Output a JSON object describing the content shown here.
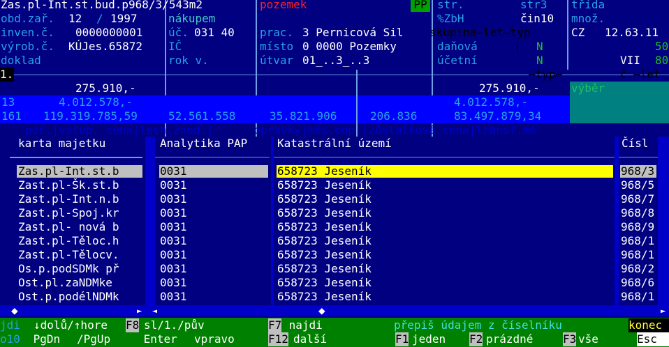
{
  "header": {
    "title": "Zas.pl-Int.st.bud.p968/3/543m2",
    "pozemek": "pozemek",
    "pp": "PP",
    "obd_label": "obd.zař.",
    "obd_month": "12",
    "obd_sep": "/",
    "obd_year": "1997",
    "inven_label": "inven.č.",
    "inven_value": "0000000001",
    "vyrob_label": "výrob.č.",
    "vyrob_value": "KÚJes.65872",
    "doklad_label": "doklad",
    "nakupem": "nákupem",
    "uc_label": "úč.",
    "uc_value": "031 40",
    "ic_label": "IČ",
    "rok_label": "rok v.",
    "prac_label": "prac.",
    "prac_value": "3 Pernicová Sil",
    "misto_label": "místo",
    "misto_value": "0 0000 Pozemky",
    "utvar_label": "útvar",
    "utvar_value": "01_..3_..3",
    "str_label": "str.",
    "zbh_label": "%ZbH",
    "skupina_line": "skupina—let—typ",
    "danova_label": "daňová",
    "danova_value": "N",
    "ucetni_label": "účetní",
    "ucetni_value": "N",
    "str3_label": "str3",
    "cin_label": "čin10",
    "cz_label": "CZ",
    "trida_label": "třída",
    "mnoz_label": "množ.",
    "cz_value": "12.63.11",
    "cz_val2": "50",
    "cz_val3": "80",
    "vii": "VII",
    "typ_line": "—typ—",
    "clet_line": "č.—let",
    "row_indicator": "1."
  },
  "values": {
    "row1_vstup": "275.910,-",
    "row1_zust": "275.910,-",
    "row2_num": "13",
    "row2_vstup": "4.012.578,-",
    "row2_zust": "4.012.578,-",
    "row3_num": "161",
    "row3_vstup": "119.319.785,59",
    "row3_tech": "52.561.558",
    "row3_opravky": "35.821.906",
    "row3_mes": "206.836",
    "row3_zust": "83.497.879,34",
    "vyber": "výběr",
    "labels": "poč.|vstup. cena|tech.zhod.|      opravky|měs.odp.|zůstatková cena|transf.mě"
  },
  "columns": {
    "karta": "karta majetku",
    "analytika": "Analytika PAP",
    "katastr": "Katastrální území",
    "cisl": "Čísl"
  },
  "rows": [
    {
      "karta": "Zas.pl-Int.st.b",
      "analytika": "0031",
      "katastr": "658723 Jeseník",
      "cisl": "968/3"
    },
    {
      "karta": "Zast.pl-Šk.st.b",
      "analytika": "0031",
      "katastr": "658723 Jeseník",
      "cisl": "968/5"
    },
    {
      "karta": "Zast.pl-Int.n.b",
      "analytika": "0031",
      "katastr": "658723 Jeseník",
      "cisl": "968/7"
    },
    {
      "karta": "Zast.pl-Spoj.kr",
      "analytika": "0031",
      "katastr": "658723 Jeseník",
      "cisl": "968/8"
    },
    {
      "karta": "Zast.pl- nová b",
      "analytika": "0031",
      "katastr": "658723 Jeseník",
      "cisl": "968/9"
    },
    {
      "karta": "Zast.pl-Těloc.h",
      "analytika": "0031",
      "katastr": "658723 Jeseník",
      "cisl": "968/1"
    },
    {
      "karta": "Zast.pl-Tělocv.",
      "analytika": "0031",
      "katastr": "658723 Jeseník",
      "cisl": "968/1"
    },
    {
      "karta": "Os.p.podSDMk př",
      "analytika": "0031",
      "katastr": "658723 Jeseník",
      "cisl": "968/2"
    },
    {
      "karta": "Ost.pl.zaNDMke ",
      "analytika": "0031",
      "katastr": "658723 Jeseník",
      "cisl": "968/6"
    },
    {
      "karta": "Ost.p.podélNDMk",
      "analytika": "0031",
      "katastr": "658723 Jeseník",
      "cisl": "968/1"
    }
  ],
  "footer": {
    "jdi": "jdi",
    "dolu": "↓dolů/↑hore",
    "f8": "F8",
    "f8_text": "sl/1./pův",
    "f7": "F7",
    "f7_text": " najdi",
    "prepis": "přepiš údajem z číselníku",
    "konec": "konec",
    "o10": "o10",
    "pgdn": " PgDn ",
    "pgup": "/PgUp",
    "enter": " Enter ",
    "vpravo": "vpravo",
    "f12": "F12",
    "dalsi": "další",
    "f1": "F1",
    "jeden": "jeden",
    "f2": "F2",
    "prazdne": "prázdné",
    "f3": "F3",
    "vse": "vše",
    "esc": "Esc"
  },
  "colors": {
    "background": "#000080",
    "highlight_blue": "#0000ff",
    "selected_yellow": "#ffff00",
    "selected_gray": "#c0c0c0",
    "teal": "#008080",
    "footer_green": "#008000"
  }
}
